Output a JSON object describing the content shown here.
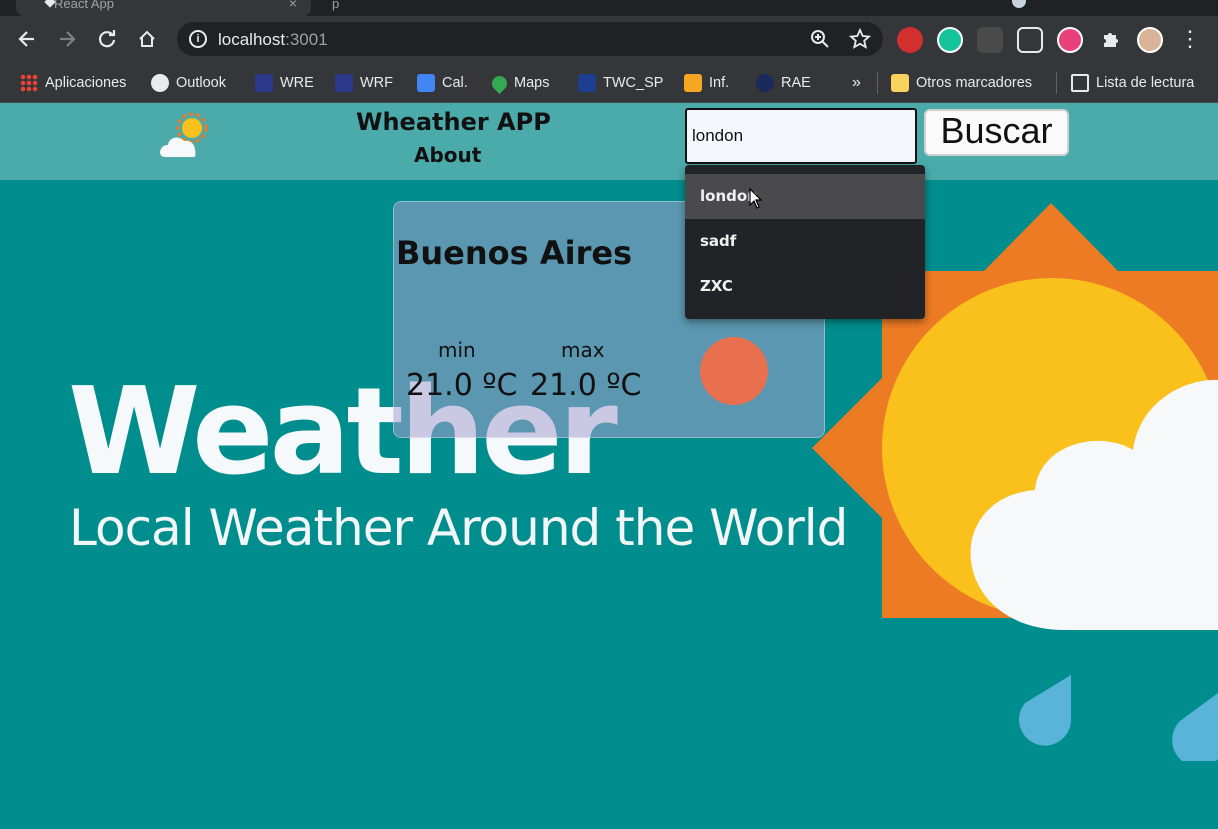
{
  "browser": {
    "tab_title": "React App",
    "tab_2_fragment": "p",
    "url_host": "localhost",
    "url_port": ":3001",
    "toolbar_icons": [
      "back-icon",
      "forward-icon",
      "reload-icon",
      "home-icon",
      "info-icon",
      "zoom-icon",
      "star-icon",
      "extensions-icon",
      "menu-icon"
    ],
    "bookmarks": [
      {
        "label": "Aplicaciones",
        "icon": "apps-grid-icon"
      },
      {
        "label": "Outlook",
        "icon": "globe-icon"
      },
      {
        "label": "WRE",
        "icon": "wordreference-icon"
      },
      {
        "label": "WRF",
        "icon": "wordreference-icon"
      },
      {
        "label": "Cal.",
        "icon": "calendar-icon"
      },
      {
        "label": "Maps",
        "icon": "maps-pin-icon"
      },
      {
        "label": "TWC_SP",
        "icon": "weather-channel-icon"
      },
      {
        "label": "Inf.",
        "icon": "info-orange-icon"
      },
      {
        "label": "RAE",
        "icon": "rae-icon"
      }
    ],
    "overflow_label": "»",
    "other_bookmarks": "Otros marcadores",
    "reading_list": "Lista de lectura"
  },
  "app": {
    "title": "Wheather APP",
    "about": "About",
    "search_value": "london",
    "search_button": "Buscar",
    "dropdown": [
      "london",
      "sadf",
      "ZXC"
    ],
    "hero_title": "Weather",
    "hero_subtitle": "Local Weather Around the World",
    "card": {
      "city": "Buenos Aires",
      "min_label": "min",
      "max_label": "max",
      "min_value": "21.0 ºC",
      "max_value": "21.0 ºC"
    }
  },
  "colors": {
    "page_bg": "#008d8d",
    "header_bg": "#4aabaa",
    "sun_orange": "#ec7b24",
    "sun_yellow": "#fac11c",
    "cloud": "#f7f8fa",
    "rain": "#5ab3d9"
  }
}
